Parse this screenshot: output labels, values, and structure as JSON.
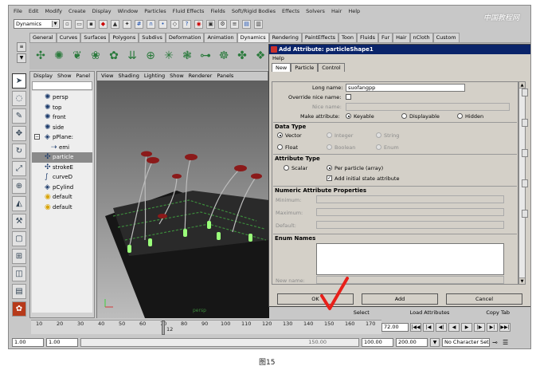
{
  "menubar": [
    "File",
    "Edit",
    "Modify",
    "Create",
    "Display",
    "Window",
    "Particles",
    "Fluid Effects",
    "Fields",
    "Soft/Rigid Bodies",
    "Effects",
    "Solvers",
    "Hair",
    "Help"
  ],
  "status": {
    "menuset": "Dynamics"
  },
  "shelf_tabs": [
    "General",
    "Curves",
    "Surfaces",
    "Polygons",
    "Subdivs",
    "Deformation",
    "Animation",
    "Dynamics",
    "Rendering",
    "PaintEffects",
    "Toon",
    "Fluids",
    "Fur",
    "Hair",
    "nCloth",
    "Custom"
  ],
  "shelf_active": "Dynamics",
  "outliner": {
    "menu": [
      "Display",
      "Show",
      "Panel"
    ],
    "items": [
      {
        "label": "persp",
        "icon": "camera-icon",
        "selected": false
      },
      {
        "label": "top",
        "icon": "camera-icon",
        "selected": false
      },
      {
        "label": "front",
        "icon": "camera-icon",
        "selected": false
      },
      {
        "label": "side",
        "icon": "camera-icon",
        "selected": false
      },
      {
        "label": "pPlane:",
        "icon": "mesh-icon",
        "selected": false,
        "expandable": true
      },
      {
        "label": "emi",
        "icon": "emitter-icon",
        "selected": false
      },
      {
        "label": "particle",
        "icon": "particle-icon",
        "selected": true
      },
      {
        "label": "strokeE",
        "icon": "stroke-icon",
        "selected": false
      },
      {
        "label": "curveD",
        "icon": "curve-icon",
        "selected": false
      },
      {
        "label": "pCylind",
        "icon": "mesh-icon",
        "selected": false
      },
      {
        "label": "default",
        "icon": "light-icon",
        "selected": false
      },
      {
        "label": "default",
        "icon": "light-icon",
        "selected": false
      }
    ]
  },
  "viewport": {
    "menu": [
      "View",
      "Shading",
      "Lighting",
      "Show",
      "Renderer",
      "Panels"
    ]
  },
  "dialog": {
    "title": "Add Attribute: particleShape1",
    "menu": "Help",
    "tabs": [
      "New",
      "Particle",
      "Control"
    ],
    "long_name_label": "Long name:",
    "long_name_value": "suofangpp",
    "override_label": "Override nice name:",
    "nice_name_label": "Nice name:",
    "make_attr_label": "Make attribute:",
    "make_attr_options": [
      "Keyable",
      "Displayable",
      "Hidden"
    ],
    "data_type_title": "Data Type",
    "data_types": [
      "Vector",
      "Integer",
      "String",
      "Float",
      "Boolean",
      "Enum"
    ],
    "attr_type_title": "Attribute Type",
    "attr_types": [
      "Scalar",
      "Per particle (array)"
    ],
    "initial_state_label": "Add initial state attribute",
    "numeric_title": "Numeric Attribute Properties",
    "numeric_fields": [
      "Minimum:",
      "Maximum:",
      "Default:"
    ],
    "enum_title": "Enum Names",
    "new_name_label": "New name:",
    "buttons": {
      "ok": "OK",
      "add": "Add",
      "cancel": "Cancel"
    }
  },
  "below_tabs": [
    "Select",
    "Load Attributes",
    "Copy Tab"
  ],
  "timeline": {
    "ticks": [
      "10",
      "20",
      "30",
      "40",
      "50",
      "60",
      "70",
      "80",
      "90",
      "100",
      "110",
      "120",
      "130",
      "140",
      "150",
      "160",
      "170"
    ],
    "current_marker": "12",
    "current_frame": "72.00"
  },
  "range": {
    "start": "1.00",
    "start2": "1.00",
    "slider_value": "150.00",
    "end": "100.00",
    "end2": "200.00",
    "character": "No Character Set"
  },
  "viewport_label": "persp",
  "caption": "图15",
  "watermark": "中国教程网",
  "colors": {
    "title_bar": "#0a246a",
    "selected_row": "#8a8a8a",
    "checkmark": "#e8201a",
    "flower": "#8b1a1a"
  }
}
